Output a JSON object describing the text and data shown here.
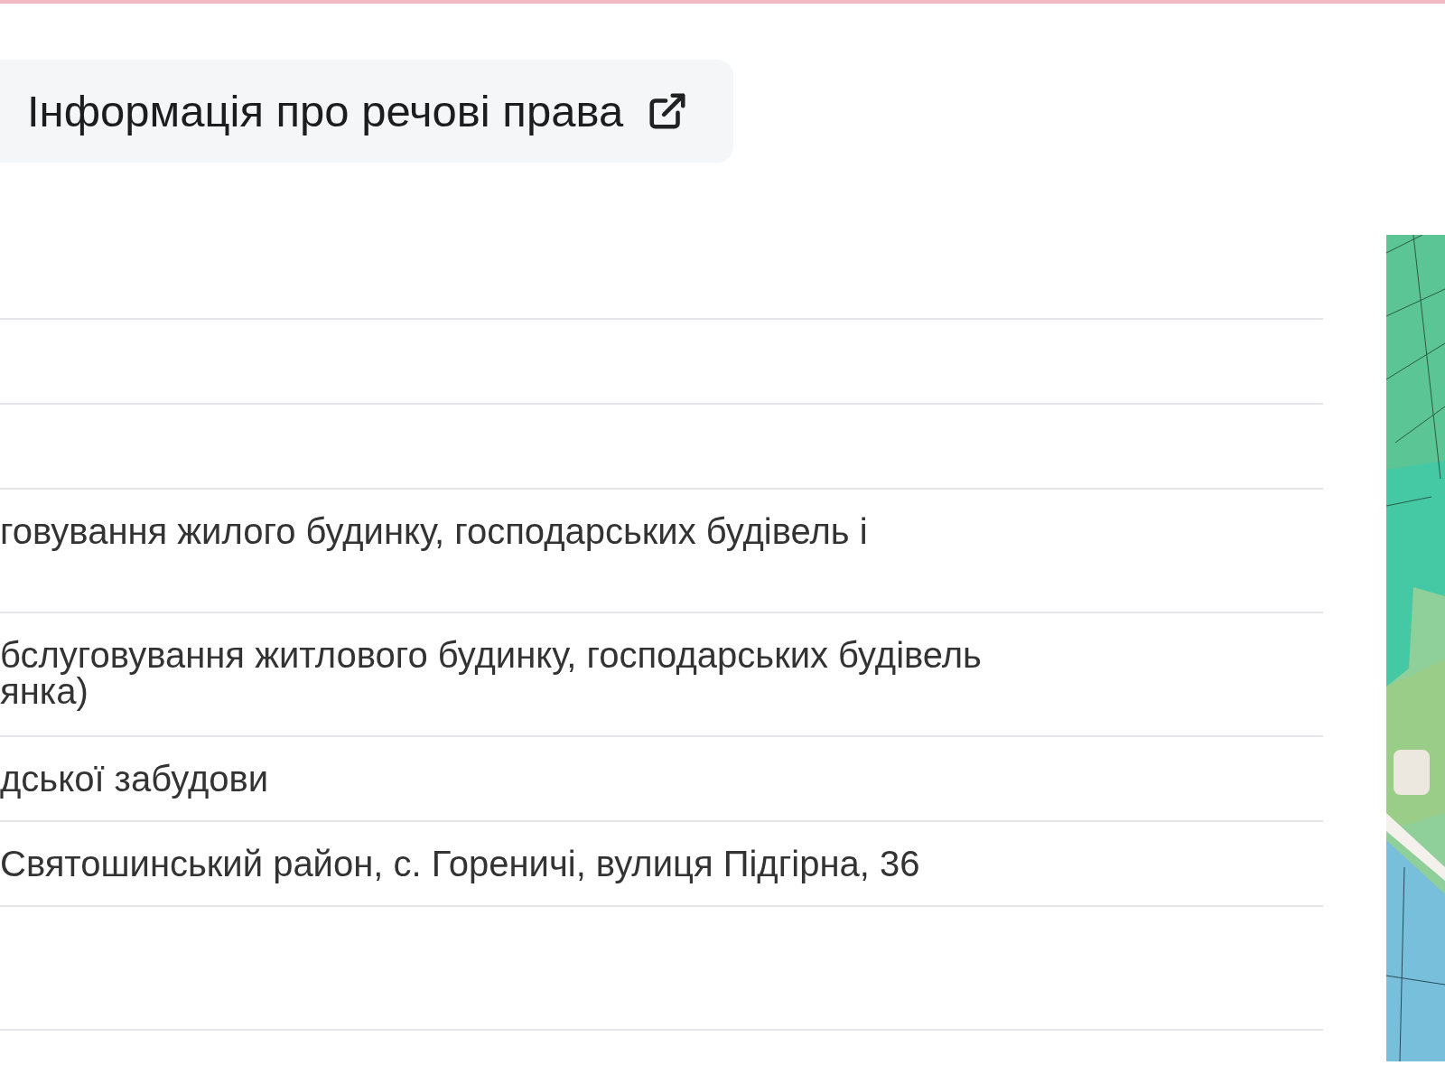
{
  "rights_button": {
    "label": "Інформація про речові права"
  },
  "table": {
    "rows": [
      {
        "kind": "single"
      },
      {
        "kind": "single"
      },
      {
        "kind": "single"
      },
      {
        "kind": "double",
        "lines": [
          "говування жилого будинку, господарських будівель і"
        ]
      },
      {
        "kind": "double",
        "lines": [
          "бслуговування житлового будинку, господарських будівель",
          "янка)"
        ]
      },
      {
        "kind": "single",
        "lines": [
          "дської забудови"
        ]
      },
      {
        "kind": "single",
        "lines": [
          "Святошинський район, с. Гореничі, вулиця Підгірна, 36"
        ]
      },
      {
        "kind": "double"
      }
    ]
  }
}
